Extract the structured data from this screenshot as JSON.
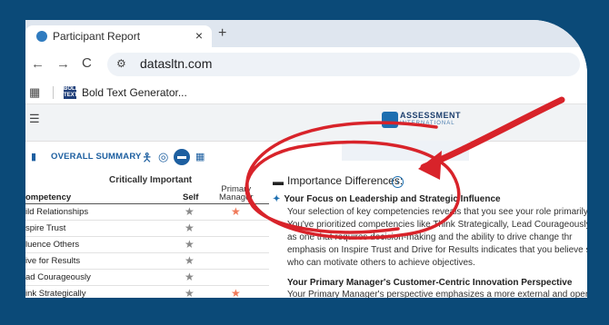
{
  "browser": {
    "tab_title": "Participant Report",
    "tab_close": "×",
    "new_tab": "+",
    "back": "←",
    "forward": "→",
    "reload": "C",
    "url": "datasltn.com",
    "bookmark_label": "Bold Text Generator...",
    "bookmark_icon_text": "BOLD TEXT"
  },
  "logo": {
    "name": "ASSESSMENT",
    "sub": "INTERNATIONAL"
  },
  "summary": {
    "title": "OVERALL SUMMARY",
    "critically_important": "Critically Important",
    "col_primary_line1": "Primary",
    "col_primary_line2": "Manager",
    "col_competency": "ompetency",
    "col_self": "Self",
    "rows": [
      {
        "name": "ild Relationships",
        "self": "★",
        "mgr": "★"
      },
      {
        "name": "spire Trust",
        "self": "★",
        "mgr": ""
      },
      {
        "name": "luence Others",
        "self": "★",
        "mgr": ""
      },
      {
        "name": "ive for Results",
        "self": "★",
        "mgr": ""
      },
      {
        "name": "ad Courageously",
        "self": "★",
        "mgr": ""
      },
      {
        "name": "ink Strategically",
        "self": "★",
        "mgr": "★"
      }
    ]
  },
  "importance": {
    "title": "Importance Differences:",
    "info": "i",
    "section1_title": "Your Focus on Leadership and Strategic Influence",
    "section1_lines": [
      "Your selection of key competencies reveals that you see your role primarily t",
      "You've prioritized competencies like Think Strategically, Lead Courageously,",
      "as one that requires decision-making and the ability to drive change thr",
      "emphasis on Inspire Trust and Drive for Results indicates that you believe su",
      "who can motivate others to achieve objectives."
    ],
    "section2_title": "Your Primary Manager's Customer-Centric Innovation Perspective",
    "section2_line": "Your Primary Manager's perspective emphasizes a more external and oper"
  },
  "colors": {
    "frame": "#0b4a78",
    "accent": "#1d5fa0",
    "annotation": "#d8232a",
    "manager_star": "#f07a5a"
  },
  "icons": [
    "person-icon",
    "target-icon",
    "chat-icon",
    "grid-icon",
    "sparkle-icon"
  ]
}
